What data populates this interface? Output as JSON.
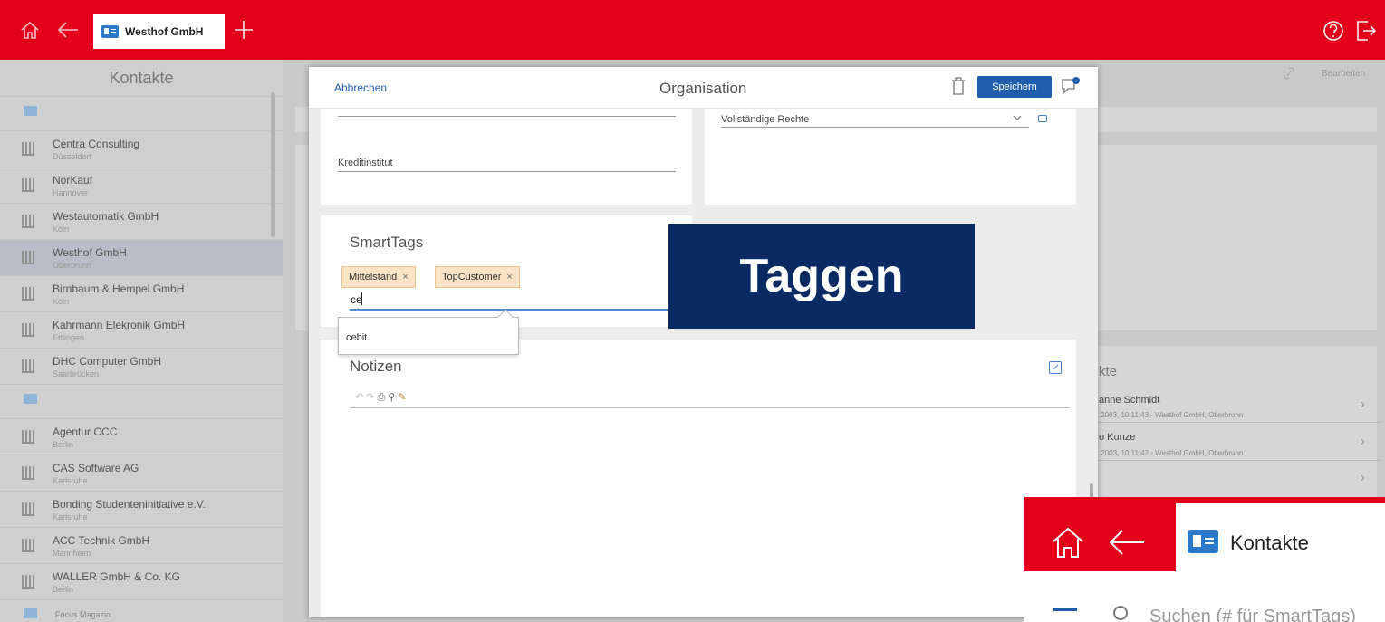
{
  "topbar": {
    "tab_label": "Westhof GmbH",
    "icons": [
      "home-icon",
      "back-icon",
      "add-tab-icon",
      "help-icon",
      "logout-icon"
    ]
  },
  "sidebar": {
    "title": "Kontakte",
    "items": [
      {
        "name": "Centra Consulting",
        "city": "Düsseldorf"
      },
      {
        "name": "NorKauf",
        "city": "Hannover"
      },
      {
        "name": "Westautomatik GmbH",
        "city": "Köln"
      },
      {
        "name": "Westhof GmbH",
        "city": "Oberbrunn",
        "active": true
      },
      {
        "name": "Birnbaum & Hempel GmbH",
        "city": "Köln"
      },
      {
        "name": "Kahrmann Elekronik GmbH",
        "city": "Ettlingen"
      },
      {
        "name": "DHC Computer GmbH",
        "city": "Saarbrücken"
      }
    ],
    "items2": [
      {
        "name": "Agentur CCC",
        "city": "Berlin"
      },
      {
        "name": "CAS Software AG",
        "city": "Karlsruhe"
      },
      {
        "name": "Bonding Studenteninitiative e.V.",
        "city": "Karlsruhe"
      },
      {
        "name": "ACC Technik GmbH",
        "city": "Mannheim"
      },
      {
        "name": "WALLER GmbH & Co. KG",
        "city": "Berlin"
      }
    ],
    "last_item": "Focus Magazin"
  },
  "background": {
    "edit_label": "Bearbeiten",
    "activities_title": "kte",
    "activities": [
      {
        "name": "anne Schmidt",
        "date": ".2003, 10:11:43 - Westhof GmbH, Oberbrunn"
      },
      {
        "name": "o Kunze",
        "date": ".2003, 10:11:42 - Westhof GmbH, Oberbrunn"
      }
    ]
  },
  "modal": {
    "cancel_label": "Abbrechen",
    "title": "Organisation",
    "save_label": "Speichern",
    "kredit_label": "Kreditinstitut",
    "rights_value": "Vollständige Rechte",
    "smarttags_title": "SmartTags",
    "tags": [
      "Mittelstand",
      "TopCustomer"
    ],
    "tag_remove": "×",
    "tag_input_value": "ce",
    "suggestion": "cebit",
    "notes_title": "Notizen"
  },
  "overlay": {
    "taggen": "Taggen"
  },
  "inset": {
    "tab_label": "Kontakte",
    "search_placeholder": "Suchen (# für SmartTags)"
  }
}
